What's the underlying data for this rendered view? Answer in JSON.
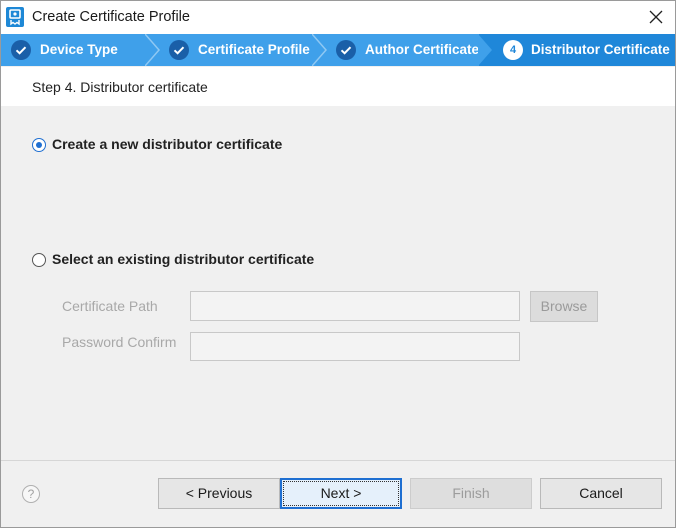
{
  "window": {
    "title": "Create Certificate Profile"
  },
  "steps": [
    {
      "label": "Device Type",
      "state": "done"
    },
    {
      "label": "Certificate Profile",
      "state": "done"
    },
    {
      "label": "Author Certificate",
      "state": "done"
    },
    {
      "label": "Distributor Certificate",
      "state": "active",
      "number": "4"
    }
  ],
  "header": {
    "text": "Step 4. Distributor certificate"
  },
  "options": {
    "create_new": {
      "label": "Create a new distributor certificate",
      "selected": true
    },
    "select_existing": {
      "label": "Select an existing distributor certificate",
      "selected": false
    }
  },
  "fields": {
    "certificate_path": {
      "label": "Certificate Path",
      "value": ""
    },
    "password_confirm": {
      "label": "Password Confirm",
      "value": ""
    },
    "browse_label": "Browse"
  },
  "footer": {
    "help": "?",
    "previous": "< Previous",
    "next": "Next >",
    "finish": "Finish",
    "cancel": "Cancel"
  },
  "colors": {
    "stepbar": "#3fa0ea",
    "active_step": "#1f87d9",
    "accent": "#1f6fd1"
  }
}
